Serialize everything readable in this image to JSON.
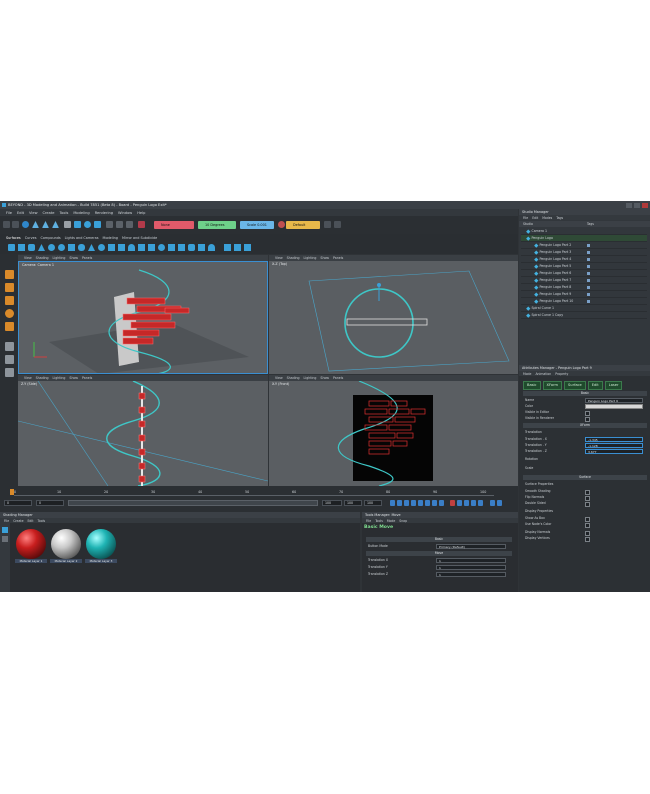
{
  "window": {
    "title": "BEYOND - 3D Modeling and Animation - Build 7851 (Beta 8) - Board - Penguin Logo Exit*"
  },
  "menu": [
    "File",
    "Edit",
    "View",
    "Create",
    "Tools",
    "Modeling",
    "Rendering",
    "Window",
    "Help"
  ],
  "toolbar": {
    "snap_none": "None",
    "angle_snap": "10 Degrees",
    "scale_snap": "Scale 0.001",
    "layout": "Default"
  },
  "category_tabs": [
    "Surfaces",
    "Curves",
    "Compounds",
    "Lights and Cameras",
    "Modeling",
    "Mirror and Subdivide"
  ],
  "viewport_menu": [
    "View",
    "Shading",
    "Lighting",
    "Show",
    "Panels"
  ],
  "viewports": [
    {
      "label": "Camera: Camera 1"
    },
    {
      "label": "X-Z (Top)"
    },
    {
      "label": "Z-Y (Side)"
    },
    {
      "label": "X-Y (Front)"
    }
  ],
  "timeline": {
    "ticks": [
      "0",
      "10",
      "20",
      "30",
      "40",
      "50",
      "60",
      "70",
      "80",
      "90",
      "100"
    ],
    "start": "0",
    "current": "0",
    "end": "100",
    "fields": [
      "100",
      "100",
      "100"
    ]
  },
  "shading_manager": {
    "title": "Shading Manager",
    "menu": [
      "File",
      "Create",
      "Edit",
      "Tools"
    ],
    "materials": [
      {
        "name": "Material Layer 1",
        "color": "#c81e1e"
      },
      {
        "name": "Material Layer 2",
        "color": "#c8c8c8"
      },
      {
        "name": "Material Layer 3",
        "color": "#1fb4b4"
      }
    ]
  },
  "tools_manager": {
    "title": "Tools Manager: Move",
    "menu": [
      "File",
      "Tools",
      "Mode",
      "Snap"
    ],
    "header": "Basic Move",
    "section_basic": "Basic",
    "button_mode_label": "Button Mode",
    "button_mode_value": "Primary (Default)",
    "section_move": "Move",
    "rows": [
      {
        "label": "Translation X",
        "value": "1"
      },
      {
        "label": "Translation Y",
        "value": "1"
      },
      {
        "label": "Translation Z",
        "value": "1"
      }
    ]
  },
  "studio_manager": {
    "title": "Studio Manager",
    "menu": [
      "File",
      "Edit",
      "Modes",
      "Tags"
    ],
    "columns": [
      "Studio",
      "Tags"
    ],
    "items": [
      {
        "name": "Camera 1",
        "indent": 1
      },
      {
        "name": "Penguin Logo",
        "indent": 1
      },
      {
        "name": "Penguin Logo Part 2",
        "indent": 2
      },
      {
        "name": "Penguin Logo Part 3",
        "indent": 2
      },
      {
        "name": "Penguin Logo Part 4",
        "indent": 2
      },
      {
        "name": "Penguin Logo Part 5",
        "indent": 2
      },
      {
        "name": "Penguin Logo Part 6",
        "indent": 2
      },
      {
        "name": "Penguin Logo Part 7",
        "indent": 2
      },
      {
        "name": "Penguin Logo Part 8",
        "indent": 2
      },
      {
        "name": "Penguin Logo Part 9",
        "indent": 2
      },
      {
        "name": "Penguin Logo Part 10",
        "indent": 2
      },
      {
        "name": "Spiral Curve 1",
        "indent": 1
      },
      {
        "name": "Spiral Curve 1 Copy",
        "indent": 1
      }
    ]
  },
  "attributes_manager": {
    "title": "Attributes Manager - Penguin Logo Part 9",
    "menu": [
      "Mode",
      "Animation",
      "Property"
    ],
    "tabs": [
      "Basic",
      "XForm",
      "Surface",
      "Edit",
      "Laser"
    ],
    "section_basic": "Basic",
    "basic_rows": [
      {
        "label": "Name",
        "value": "Penguin Logo Part 9"
      },
      {
        "label": "Color",
        "value": ""
      },
      {
        "label": "Visible in Editor",
        "value": ""
      },
      {
        "label": "Visible in Renderer",
        "value": ""
      }
    ],
    "section_xform": "XForm",
    "translation_label": "Translation",
    "translation_rows": [
      {
        "label": "Translation . X",
        "value": "-1.345"
      },
      {
        "label": "Translation . Y",
        "value": "-1.128"
      },
      {
        "label": "Translation . Z",
        "value": "3.677"
      }
    ],
    "rotation_label": "Rotation",
    "scale_label": "Scale",
    "section_surface": "Surface",
    "surface_props_label": "Surface Properties",
    "surface_rows": [
      "Smooth Shading",
      "Flip Normals",
      "Double Sided"
    ],
    "display_props_label": "Display Properties",
    "display_rows": [
      "Show As Box",
      "Use Node's Color",
      "Display Normals",
      "Display Vertices"
    ]
  },
  "colors": {
    "accent_blue": "#3a8fd2",
    "logo_red": "#c62828",
    "spiral_cyan": "#3ec7c7"
  }
}
